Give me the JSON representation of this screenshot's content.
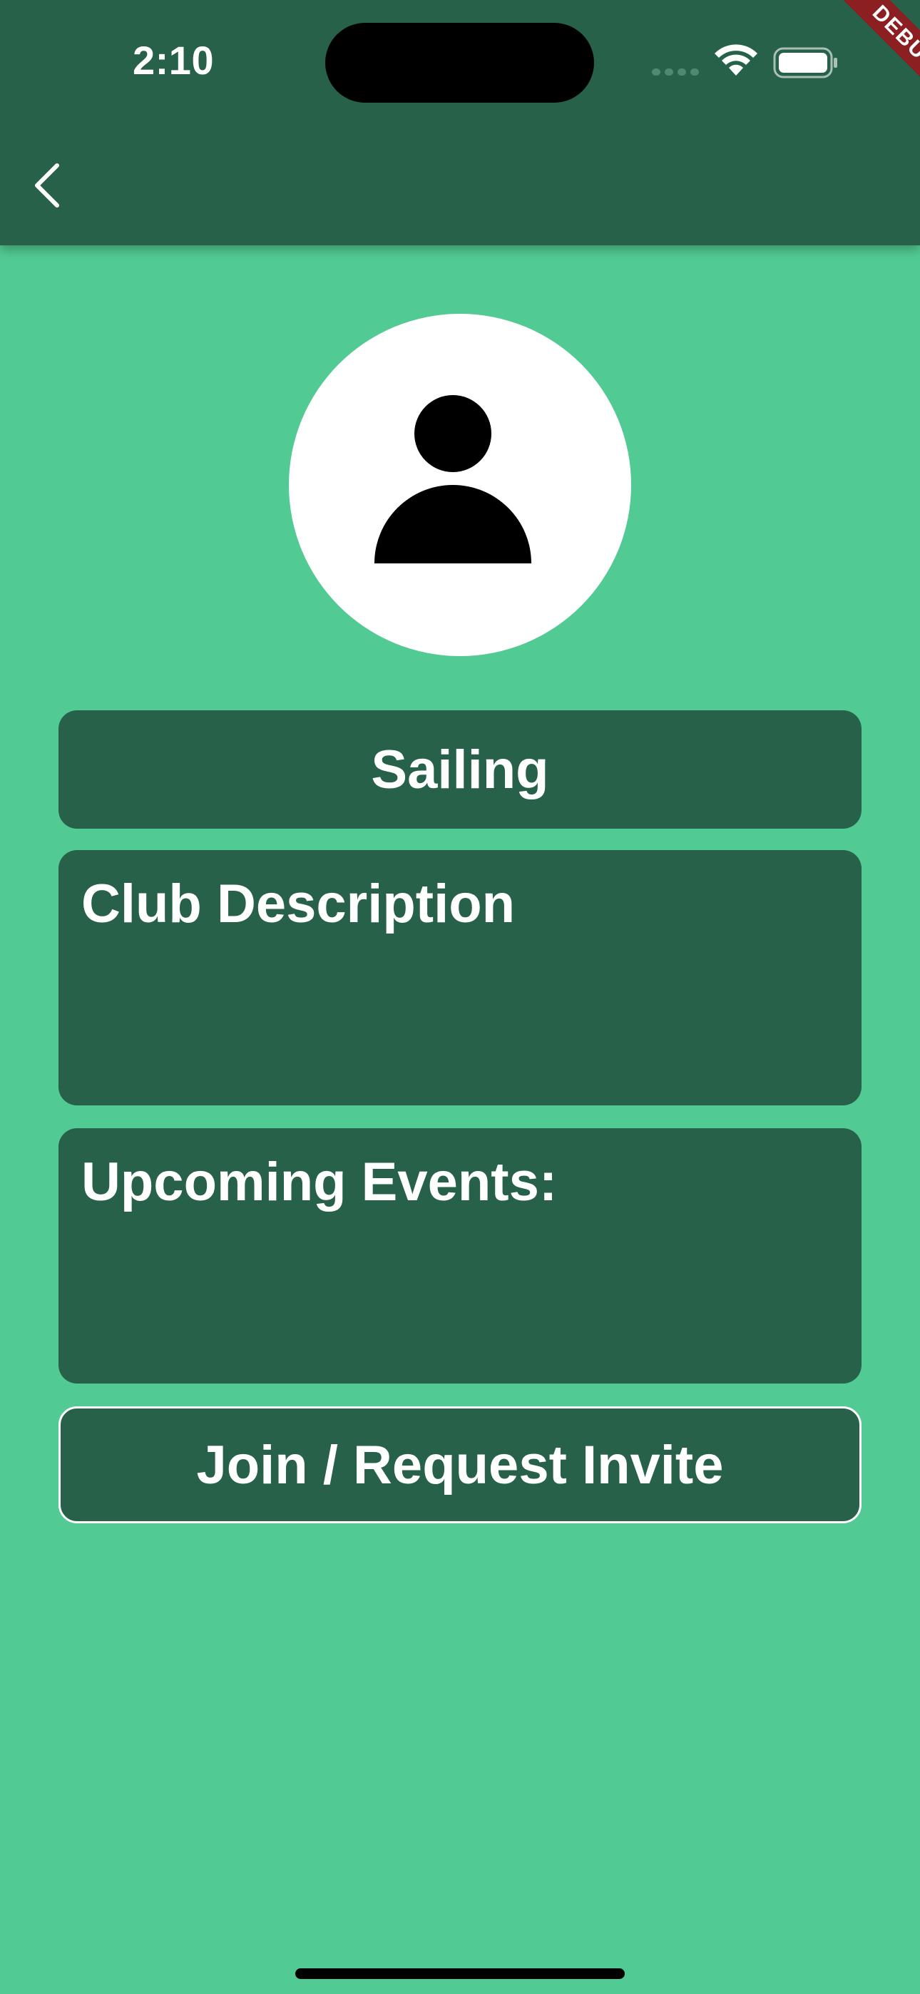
{
  "status_bar": {
    "time": "2:10",
    "signal_icon": "cellular-signal-icon",
    "wifi_icon": "wifi-icon",
    "battery_icon": "battery-icon"
  },
  "app_bar": {
    "back_icon": "chevron-left-icon",
    "debug_banner": "DEBUG"
  },
  "profile": {
    "avatar_icon": "person-icon"
  },
  "club": {
    "name": "Sailing",
    "description_title": "Club Description",
    "events_title": "Upcoming Events:",
    "join_label": "Join / Request Invite"
  },
  "colors": {
    "background": "#52ca93",
    "app_bar": "#276149",
    "card": "#276149",
    "text": "#ffffff",
    "debug_banner": "#8b1f22"
  }
}
